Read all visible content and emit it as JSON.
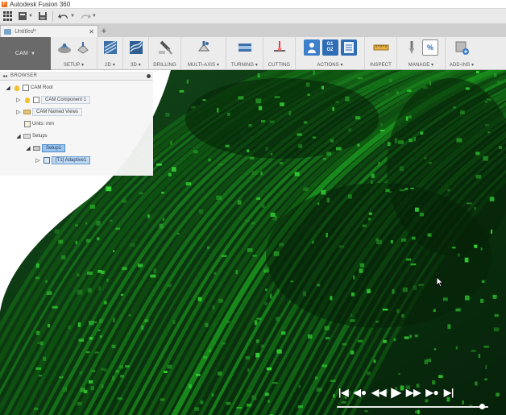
{
  "window": {
    "title": "Autodesk Fusion 360"
  },
  "quick_access": {
    "icons": [
      "apps-grid-icon",
      "file-icon",
      "save-icon",
      "undo-icon",
      "redo-icon"
    ]
  },
  "tabs": [
    {
      "label": "Untitled*",
      "close": "✕"
    }
  ],
  "tab_add": "+",
  "ribbon": {
    "workspace": "CAM",
    "workspace_caret": "▼",
    "groups": [
      {
        "label": "SETUP ▾"
      },
      {
        "label": "2D ▾"
      },
      {
        "label": "3D ▾"
      },
      {
        "label": "DRILLING"
      },
      {
        "label": "MULTI-AXIS ▾"
      },
      {
        "label": "TURNING ▾"
      },
      {
        "label": "CUTTING"
      },
      {
        "label": "ACTIONS ▾"
      },
      {
        "label": "INSPECT"
      },
      {
        "label": "MANAGE ▾"
      },
      {
        "label": "ADD-INS ▾"
      }
    ],
    "actions_badge_top": "G1",
    "actions_badge_bottom": "G2",
    "manage_badge": "%"
  },
  "browser": {
    "title": "BROWSER",
    "collapse": "◂◂",
    "items": [
      {
        "label": "CAM Root"
      },
      {
        "label": "CAM Component 1"
      },
      {
        "label": "CAM Named Views"
      },
      {
        "label": "Units: mm"
      },
      {
        "label": "Setups"
      },
      {
        "label": "Setup1"
      },
      {
        "label": "[T1] Adaptive1"
      }
    ],
    "expand_closed": "▷",
    "expand_open": "◢"
  },
  "playback": {
    "first": "|◀",
    "prev_op": "◀●",
    "step_back": "◀◀",
    "play": "▶",
    "step_forward": "▶▶",
    "next_op": "▶●",
    "last": "▶|",
    "progress": 0.98
  },
  "colors": {
    "model_green": "#1f7a1f",
    "model_dark": "#0a2b0a",
    "selection_blue": "#9cc3eb",
    "workspace_gray": "#6a6a6a"
  }
}
